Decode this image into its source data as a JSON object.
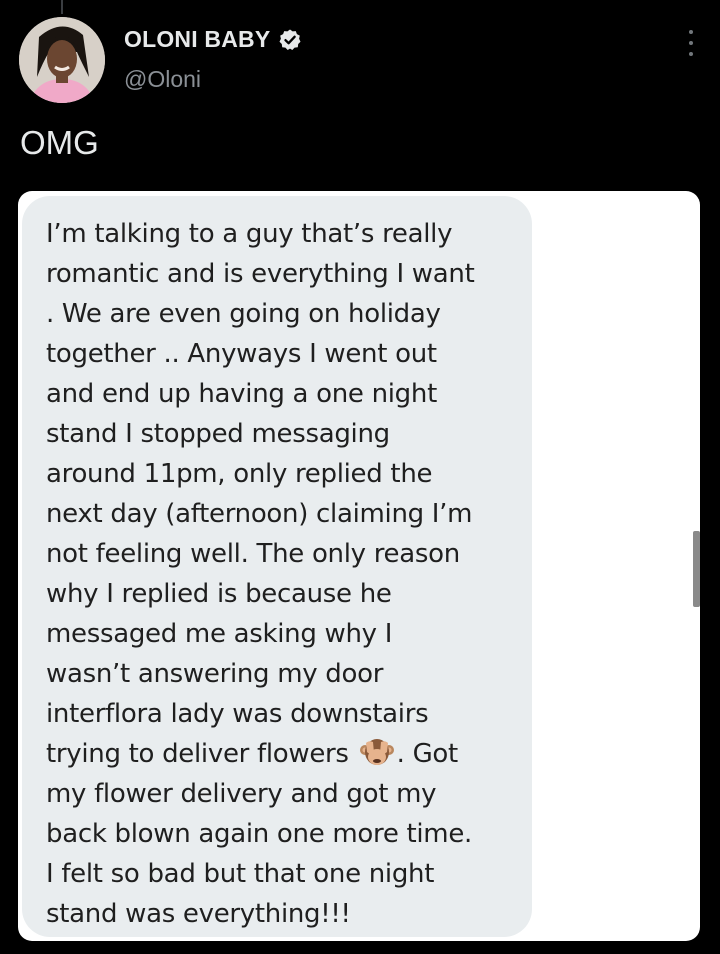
{
  "tweet": {
    "author": {
      "display_name": "OLONI BABY",
      "handle": "@Oloni",
      "verified": true,
      "avatar_icon": "profile-photo"
    },
    "text": "OMG",
    "more_icon": "more-options-icon"
  },
  "media": {
    "message_lines": [
      "I’m talking to a guy that’s really",
      "romantic and is everything I want",
      ". We are even going on holiday",
      "together .. Anyways I went out",
      "and end up having a one night",
      "stand I stopped messaging",
      "around 11pm, only replied the",
      "next day (afternoon) claiming I’m",
      "not feeling well. The only reason",
      "why I replied is because he",
      "messaged me asking why I",
      "wasn’t answering my door",
      "interflora lady was downstairs",
      "trying to deliver flowers",
      ". Got",
      "my flower delivery and got my",
      "back blown again one more time.",
      "I felt so bad but that one night",
      "stand was everything!!!"
    ],
    "emoji": "see-no-evil-monkey-icon"
  },
  "colors": {
    "background": "#000000",
    "primary_text": "#e7e9ea",
    "secondary_text": "#8b9096",
    "bubble": "#e9edef",
    "bubble_text": "#1f1f1f"
  }
}
